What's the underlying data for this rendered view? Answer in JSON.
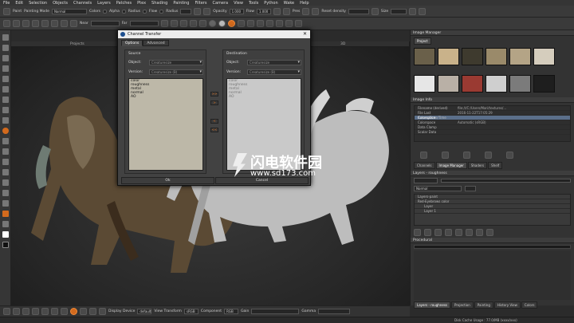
{
  "menu": [
    "File",
    "Edit",
    "Selection",
    "Objects",
    "Channels",
    "Layers",
    "Patches",
    "Ptex",
    "Shading",
    "Painting",
    "Filters",
    "Camera",
    "View",
    "Tools",
    "Python",
    "Wake",
    "Help"
  ],
  "toolbar1": {
    "paint_label": "Paint",
    "painting_mode_label": "Painting Mode",
    "painting_mode_value": "Normal",
    "colors_label": "Colors",
    "alpha_label": "Alpha",
    "radius_label": "Radius",
    "flow_label": "Flow",
    "radius2_label": "Radius",
    "opacity_label": "Opacity",
    "opacity_value": "1.000",
    "flow2_label": "Flow",
    "flow2_value": "1.000",
    "pres_label": "Pres",
    "reset_density_label": "Reset density",
    "size_label": "Size"
  },
  "toolbar2": {
    "near_label": "Near",
    "far_label": "Far"
  },
  "viewport": {
    "tabs": [
      "Projects",
      "UV",
      "3D"
    ]
  },
  "bottombar": {
    "display_device_label": "Display Device",
    "display_device_value": "default",
    "view_transform_label": "View Transform",
    "view_transform_value": "sRGB",
    "component_label": "Component",
    "component_value": "RGB",
    "gain_label": "Gain",
    "gamma_label": "Gamma"
  },
  "status": {
    "disk_cache": "Disk Cache Usage : 77.0/MB (xxxx/xxx)"
  },
  "right_panel": {
    "image_manager_title": "Image Manager",
    "project_tab": "Project",
    "image_info_title": "Image Info",
    "info_rows": [
      {
        "k": "Filename (derived)",
        "v": "file:///C:/Users/Mari/textures/..."
      },
      {
        "k": "File Last Access/Date/Time",
        "v": "2016-11-22T17:05:29"
      },
      {
        "k": "Colorspace",
        "v": ""
      },
      {
        "k": "Colorspace",
        "v": "Automatic (sRGB)"
      },
      {
        "k": "Data Clamp",
        "v": ""
      },
      {
        "k": "Scalar Data",
        "v": ""
      }
    ],
    "mid_tabs": [
      "Channels",
      "Image Manager",
      "Shaders",
      "Shelf"
    ],
    "layers_title": "Layers - roughness",
    "blend_value": "Normal",
    "layers": [
      "Layers-paint",
      "Red-Eyebrows color",
      "Layer",
      "Layer 1"
    ],
    "procedural_title": "Procedural",
    "bottom_tabs": [
      "Layers - roughness",
      "Projection",
      "Painting",
      "History View",
      "Colors"
    ]
  },
  "dialog": {
    "title": "Channel Transfer",
    "tabs": [
      "Options",
      "Advanced"
    ],
    "source": {
      "title": "Source",
      "object_label": "Object:",
      "object_value": "Creaturesize",
      "version_label": "Version:",
      "version_value": "Creaturesize (B)",
      "channels": [
        "color",
        "roughness",
        "metal",
        "normal",
        "AO"
      ]
    },
    "destination": {
      "title": "Destination",
      "object_label": "Object:",
      "object_value": "Creaturesize",
      "version_label": "Version:",
      "version_value": "Creaturesize (B)",
      "channels": [
        "color",
        "roughness",
        "metal",
        "normal",
        "AO"
      ]
    },
    "arrows": [
      ">>",
      ">",
      "<",
      "<<"
    ],
    "ok_label": "Ok",
    "cancel_label": "Cancel"
  },
  "watermark": {
    "text": "闪电软件园",
    "url": "www.sd173.com"
  }
}
